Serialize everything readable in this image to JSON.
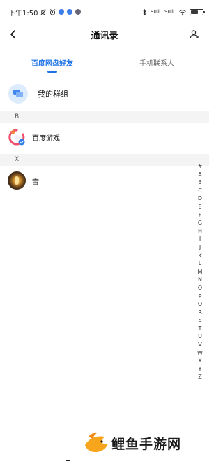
{
  "status_bar": {
    "time": "下午1:50",
    "signal1": "Sull",
    "signal2": "Sull"
  },
  "nav": {
    "title": "通讯录"
  },
  "tabs": [
    {
      "label": "百度网盘好友",
      "active": true
    },
    {
      "label": "手机联系人",
      "active": false
    }
  ],
  "group": {
    "label": "我的群组"
  },
  "sections": [
    {
      "letter": "B",
      "contacts": [
        {
          "name": "百度游戏",
          "avatar": "baidu-game-logo"
        }
      ]
    },
    {
      "letter": "X",
      "contacts": [
        {
          "name": "雪",
          "avatar": "photo-avatar"
        }
      ]
    }
  ],
  "index_letters": [
    "#",
    "A",
    "B",
    "C",
    "D",
    "E",
    "F",
    "G",
    "H",
    "I",
    "J",
    "K",
    "L",
    "M",
    "N",
    "O",
    "P",
    "Q",
    "R",
    "S",
    "T",
    "U",
    "V",
    "W",
    "X",
    "Y",
    "Z"
  ],
  "watermark": {
    "text": "鲤鱼手游网"
  },
  "colors": {
    "accent": "#1f73e6",
    "section_bg": "#f4f4f4",
    "group_icon_bg": "#dcecfc"
  }
}
